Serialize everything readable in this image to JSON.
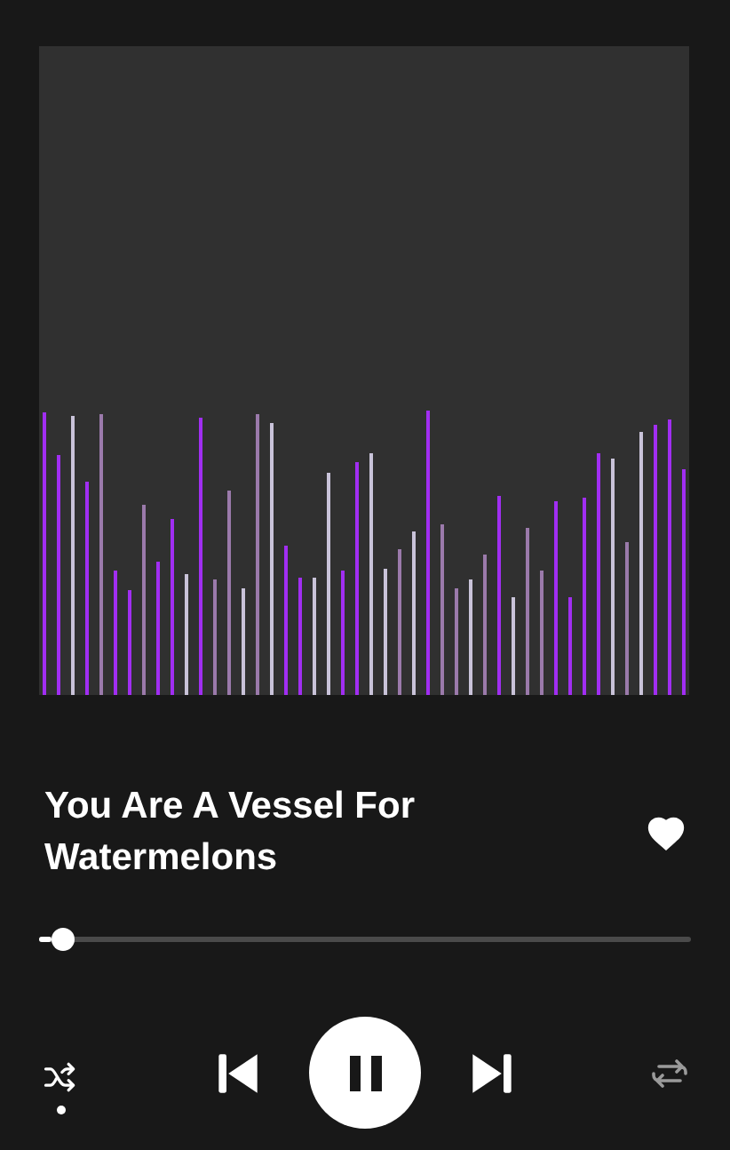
{
  "track": {
    "title": "You Are A Vessel For Watermelons",
    "liked": true
  },
  "progress": {
    "level": 0.02
  },
  "controls": {
    "shuffle": true,
    "playing": true,
    "repeat": false
  }
}
